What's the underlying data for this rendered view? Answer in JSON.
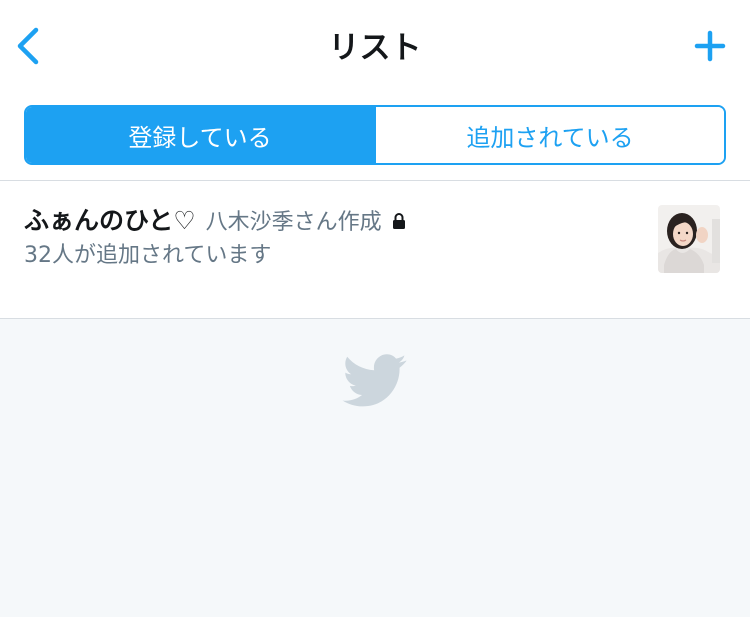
{
  "header": {
    "title": "リスト",
    "back_icon": "chevron-left-icon",
    "add_icon": "plus-icon"
  },
  "segments": [
    {
      "label": "登録している",
      "active": true
    },
    {
      "label": "追加されている",
      "active": false
    }
  ],
  "lists": [
    {
      "name": "ふぁんのひと♡",
      "owner": "八木沙季さん作成",
      "private_icon": "lock-icon",
      "member_info": "32人が追加されています",
      "thumbnail_icon": "avatar-photo"
    }
  ],
  "footer": {
    "icon": "twitter-bird-icon"
  },
  "colors": {
    "accent": "#1da1f2",
    "text_primary": "#14171a",
    "text_secondary": "#657786",
    "background": "#f5f8fa",
    "bird": "#ccd6dd"
  }
}
